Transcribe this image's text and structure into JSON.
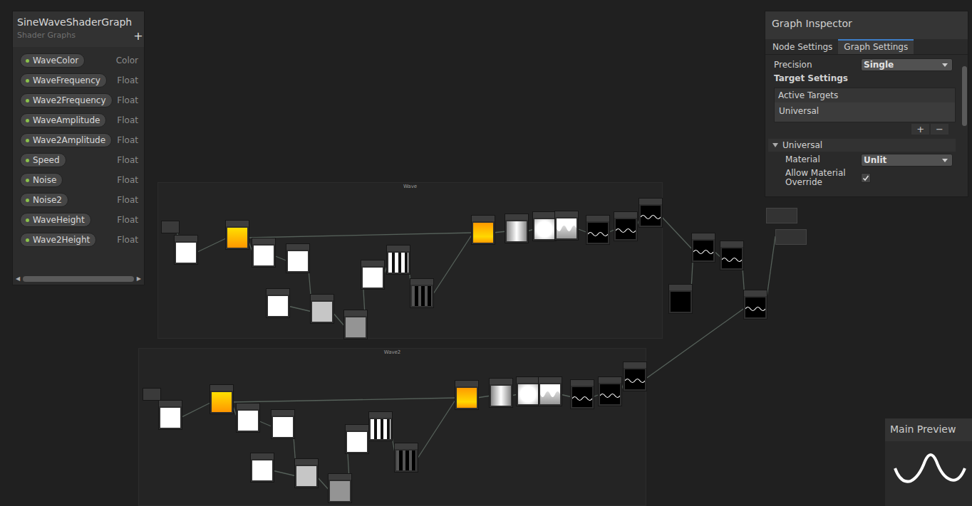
{
  "blackboard": {
    "title": "SineWaveShaderGraph",
    "subtitle": "Shader Graphs",
    "add_button": "+",
    "properties": [
      {
        "name": "WaveColor",
        "type": "Color"
      },
      {
        "name": "WaveFrequency",
        "type": "Float"
      },
      {
        "name": "Wave2Frequency",
        "type": "Float"
      },
      {
        "name": "WaveAmplitude",
        "type": "Float"
      },
      {
        "name": "Wave2Amplitude",
        "type": "Float"
      },
      {
        "name": "Speed",
        "type": "Float"
      },
      {
        "name": "Noise",
        "type": "Float"
      },
      {
        "name": "Noise2",
        "type": "Float"
      },
      {
        "name": "WaveHeight",
        "type": "Float"
      },
      {
        "name": "Wave2Height",
        "type": "Float"
      }
    ],
    "scroll_left": "◀",
    "scroll_right": "▶"
  },
  "inspector": {
    "title": "Graph Inspector",
    "tabs": [
      {
        "label": "Node Settings",
        "selected": false
      },
      {
        "label": "Graph Settings",
        "selected": true
      }
    ],
    "precision": {
      "label": "Precision",
      "value": "Single"
    },
    "target_settings": "Target Settings",
    "active_targets": {
      "header": "Active Targets",
      "items": [
        "Universal"
      ],
      "add": "+",
      "remove": "−"
    },
    "section": {
      "title": "Universal",
      "expanded": true,
      "fields": [
        {
          "kind": "dropdown",
          "label": "Material",
          "value": "Unlit"
        },
        {
          "kind": "checkbox",
          "label": "Allow Material Override",
          "checked": true
        }
      ]
    }
  },
  "graph": {
    "groups": [
      {
        "title": "Wave"
      },
      {
        "title": "Wave2"
      }
    ],
    "nodes": [
      {
        "preview": "white"
      },
      {
        "preview": "yellow"
      },
      {
        "preview": "white"
      },
      {
        "preview": "white"
      },
      {
        "preview": "white"
      },
      {
        "preview": "lightgray"
      },
      {
        "preview": "gray"
      },
      {
        "preview": "white"
      },
      {
        "preview": "bars"
      },
      {
        "preview": "bars-dark"
      },
      {
        "preview": "yellow2"
      },
      {
        "preview": "blur"
      },
      {
        "preview": "soft"
      },
      {
        "preview": "wavy"
      },
      {
        "preview": "wave"
      },
      {
        "preview": "wave"
      },
      {
        "preview": "wave"
      },
      {
        "preview": "black"
      },
      {
        "preview": "wave"
      },
      {
        "preview": "wave"
      },
      {
        "preview": "wave"
      },
      {
        "preview": "white"
      },
      {
        "preview": "yellow"
      },
      {
        "preview": "white"
      },
      {
        "preview": "white"
      },
      {
        "preview": "white"
      },
      {
        "preview": "lightgray"
      },
      {
        "preview": "gray"
      },
      {
        "preview": "white"
      },
      {
        "preview": "bars"
      },
      {
        "preview": "bars-dark"
      },
      {
        "preview": "yellow2"
      },
      {
        "preview": "blur"
      },
      {
        "preview": "soft"
      },
      {
        "preview": "wavy"
      },
      {
        "preview": "wave"
      },
      {
        "preview": "wave"
      },
      {
        "preview": "wave"
      },
      {
        "preview": "small"
      },
      {
        "preview": "small"
      },
      {
        "preview": "stack"
      },
      {
        "preview": "stack"
      }
    ],
    "edges": [
      [
        38,
        0
      ],
      [
        0,
        1
      ],
      [
        1,
        2
      ],
      [
        2,
        3
      ],
      [
        1,
        10
      ],
      [
        3,
        5
      ],
      [
        4,
        5
      ],
      [
        5,
        6
      ],
      [
        6,
        7
      ],
      [
        7,
        8
      ],
      [
        8,
        9
      ],
      [
        9,
        10
      ],
      [
        10,
        11
      ],
      [
        11,
        12
      ],
      [
        12,
        13
      ],
      [
        13,
        14
      ],
      [
        14,
        15
      ],
      [
        15,
        16
      ],
      [
        16,
        18
      ],
      [
        17,
        18
      ],
      [
        18,
        19
      ],
      [
        19,
        20
      ],
      [
        20,
        41
      ],
      [
        39,
        21
      ],
      [
        21,
        22
      ],
      [
        22,
        23
      ],
      [
        23,
        24
      ],
      [
        22,
        31
      ],
      [
        24,
        26
      ],
      [
        25,
        26
      ],
      [
        26,
        27
      ],
      [
        27,
        28
      ],
      [
        28,
        29
      ],
      [
        29,
        30
      ],
      [
        30,
        31
      ],
      [
        31,
        32
      ],
      [
        32,
        33
      ],
      [
        33,
        34
      ],
      [
        34,
        35
      ],
      [
        35,
        36
      ],
      [
        36,
        37
      ],
      [
        37,
        20
      ]
    ]
  },
  "main_preview": {
    "title": "Main Preview"
  }
}
